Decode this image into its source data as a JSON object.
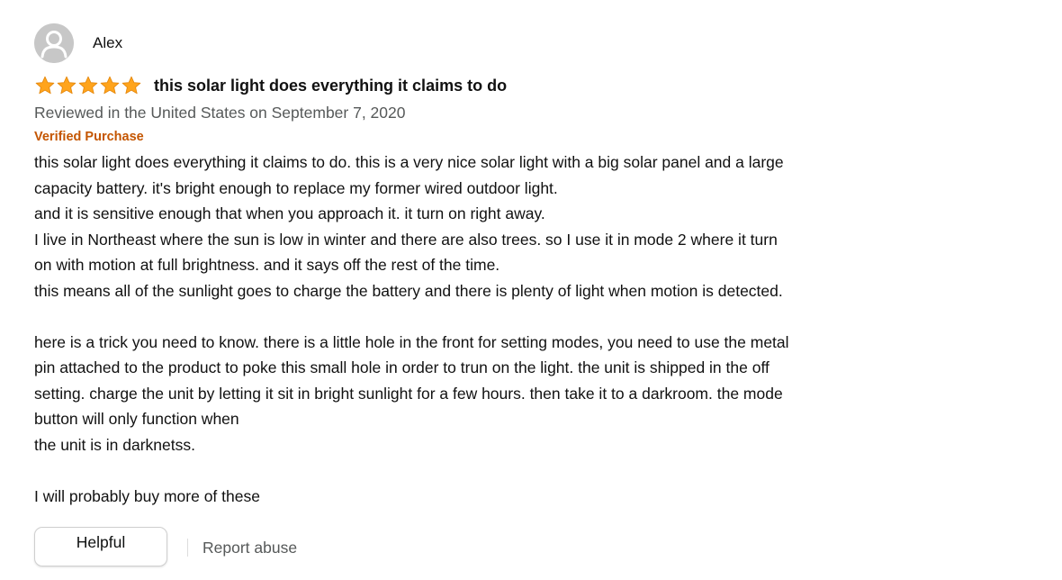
{
  "profile": {
    "name": "Alex",
    "avatar_icon": "person-silhouette-icon"
  },
  "rating": {
    "stars": 5,
    "max": 5,
    "icon": "star-icon",
    "color": "#ffa41c"
  },
  "review": {
    "title": "this solar light does everything it claims to do",
    "date_line": "Reviewed in the United States on September 7, 2020",
    "verified_label": "Verified Purchase",
    "paragraph_lines": [
      "this solar light does everything it claims to do. this is a very nice solar light with a big solar panel and a large",
      "capacity battery. it's bright enough to replace my former wired outdoor light.",
      "and it is sensitive enough that when you approach it. it turn on right away.",
      "I live in Northeast where the sun is low in winter and there are also trees. so I use it in mode 2 where it turn",
      "on with motion at full brightness. and it says off the rest of the time.",
      "this means all of the sunlight goes to charge the battery and there is plenty of light when motion is detected.",
      "",
      "here is a trick you need to know. there is a little hole in the front for setting modes, you need to use the metal",
      "pin attached to the product to poke this small hole in order to trun on the light. the unit is shipped in the off",
      "setting. charge the unit by letting it sit in bright sunlight for a few hours. then take it to a darkroom. the mode",
      "button will only function when",
      "the unit is in darknetss.",
      "",
      "I will probably buy more of these"
    ]
  },
  "actions": {
    "helpful_label": "Helpful",
    "report_label": "Report abuse"
  },
  "colors": {
    "verified": "#c45500",
    "secondary_text": "#565959",
    "star": "#ffa41c"
  }
}
